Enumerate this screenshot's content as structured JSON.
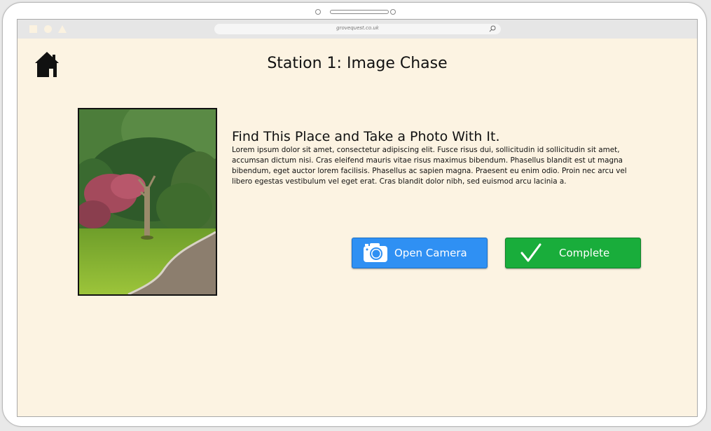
{
  "browser": {
    "url": "grovequest.co.uk"
  },
  "page": {
    "title": "Station 1: Image Chase",
    "heading": "Find This Place and Take a Photo With It.",
    "body": "Lorem ipsum dolor sit amet, consectetur adipiscing elit. Fusce risus dui, sollicitudin id sollicitudin sit amet, accumsan dictum nisi. Cras eleifend mauris vitae risus maximus bibendum. Phasellus blandit est ut magna bibendum, eget auctor lorem facilisis. Phasellus ac sapien magna. Praesent eu enim odio. Proin nec arcu vel libero egestas vestibulum vel eget erat. Cras blandit dolor nibh, sed euismod arcu lacinia a."
  },
  "buttons": {
    "open_camera": "Open Camera",
    "complete": "Complete"
  },
  "icons": {
    "home": "home-icon",
    "camera": "camera-icon",
    "check": "checkmark-icon",
    "search": "search-icon"
  },
  "colors": {
    "background": "#fcf3e2",
    "camera_button": "#2f90f3",
    "complete_button": "#19ad3b"
  }
}
